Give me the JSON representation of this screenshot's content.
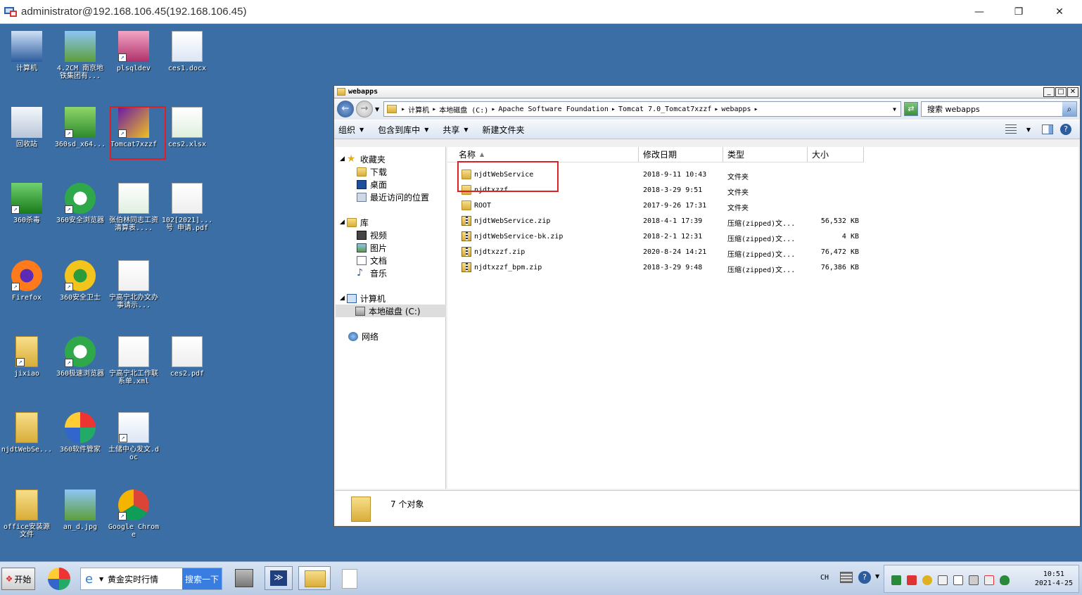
{
  "rdp": {
    "title": "administrator@192.168.106.45(192.168.106.45)",
    "minimize": "—",
    "restore": "❐",
    "close": "✕"
  },
  "desktop_icons": [
    {
      "label": "计算机",
      "icon": "computer-icon"
    },
    {
      "label": "4.2CM 南京地铁集团有...",
      "icon": "image-icon"
    },
    {
      "label": "plsqldev",
      "icon": "database-icon"
    },
    {
      "label": "ces1.docx",
      "icon": "word-icon"
    },
    {
      "label": "回收站",
      "icon": "recycle-bin-icon"
    },
    {
      "label": "360sd_x64...",
      "icon": "360sd-icon"
    },
    {
      "label": "Tomcat7xzzf",
      "icon": "tomcat-icon"
    },
    {
      "label": "ces2.xlsx",
      "icon": "excel-icon"
    },
    {
      "label": "360杀毒",
      "icon": "shield-icon"
    },
    {
      "label": "360安全浏览器",
      "icon": "browser-icon"
    },
    {
      "label": "张伯林同志工资清算表....",
      "icon": "excel-icon"
    },
    {
      "label": "102[2021]...号 申请.pdf",
      "icon": "pdf-icon"
    },
    {
      "label": "Firefox",
      "icon": "firefox-icon"
    },
    {
      "label": "360安全卫士",
      "icon": "360-guard-icon"
    },
    {
      "label": "宁高宁北办文办事请示...",
      "icon": "ue-icon"
    },
    {
      "label": "jixiao",
      "icon": "folder-icon"
    },
    {
      "label": "360极速浏览器",
      "icon": "browser-icon"
    },
    {
      "label": "宁高宁北工作联系单.xml",
      "icon": "ue-icon"
    },
    {
      "label": "ces2.pdf",
      "icon": "pdf-icon"
    },
    {
      "label": "njdtWebSe...",
      "icon": "folder-icon"
    },
    {
      "label": "360软件管家",
      "icon": "software-manager-icon"
    },
    {
      "label": "土储中心发文.doc",
      "icon": "word-icon"
    },
    {
      "label": "office安装源文件",
      "icon": "folder-icon"
    },
    {
      "label": "an_d.jpg",
      "icon": "image-icon"
    },
    {
      "label": "Google Chrome",
      "icon": "chrome-icon"
    }
  ],
  "explorer": {
    "title": "webapps",
    "breadcrumb": [
      "计算机",
      "本地磁盘 (C:)",
      "Apache Software Foundation",
      "Tomcat 7.0_Tomcat7xzzf",
      "webapps"
    ],
    "search_placeholder": "搜索 webapps",
    "toolbar": {
      "organize": "组织",
      "include": "包含到库中",
      "share": "共享",
      "new_folder": "新建文件夹"
    },
    "nav": {
      "favorites": "收藏夹",
      "downloads": "下载",
      "desktop": "桌面",
      "recent": "最近访问的位置",
      "libraries": "库",
      "videos": "视频",
      "pictures": "图片",
      "documents": "文档",
      "music": "音乐",
      "computer": "计算机",
      "local_disk": "本地磁盘 (C:)",
      "network": "网络"
    },
    "columns": {
      "name": "名称",
      "modified": "修改日期",
      "type": "类型",
      "size": "大小"
    },
    "files": [
      {
        "name": "njdtWebService",
        "modified": "2018-9-11 10:43",
        "type": "文件夹",
        "size": "",
        "kind": "folder"
      },
      {
        "name": "njdtxzzf",
        "modified": "2018-3-29 9:51",
        "type": "文件夹",
        "size": "",
        "kind": "folder"
      },
      {
        "name": "ROOT",
        "modified": "2017-9-26 17:31",
        "type": "文件夹",
        "size": "",
        "kind": "folder"
      },
      {
        "name": "njdtWebService.zip",
        "modified": "2018-4-1 17:39",
        "type": "压缩(zipped)文...",
        "size": "56,532 KB",
        "kind": "zip"
      },
      {
        "name": "njdtWebService-bk.zip",
        "modified": "2018-2-1 12:31",
        "type": "压缩(zipped)文...",
        "size": "4 KB",
        "kind": "zip"
      },
      {
        "name": "njdtxzzf.zip",
        "modified": "2020-8-24 14:21",
        "type": "压缩(zipped)文...",
        "size": "76,472 KB",
        "kind": "zip"
      },
      {
        "name": "njdtxzzf_bpm.zip",
        "modified": "2018-3-29 9:48",
        "type": "压缩(zipped)文...",
        "size": "76,386 KB",
        "kind": "zip"
      }
    ],
    "status": "7 个对象"
  },
  "taskbar": {
    "start": "开始",
    "ie_text": "黄金实时行情",
    "ie_button": "搜索一下",
    "lang": "CH",
    "time": "10:51",
    "date": "2021-4-25"
  }
}
